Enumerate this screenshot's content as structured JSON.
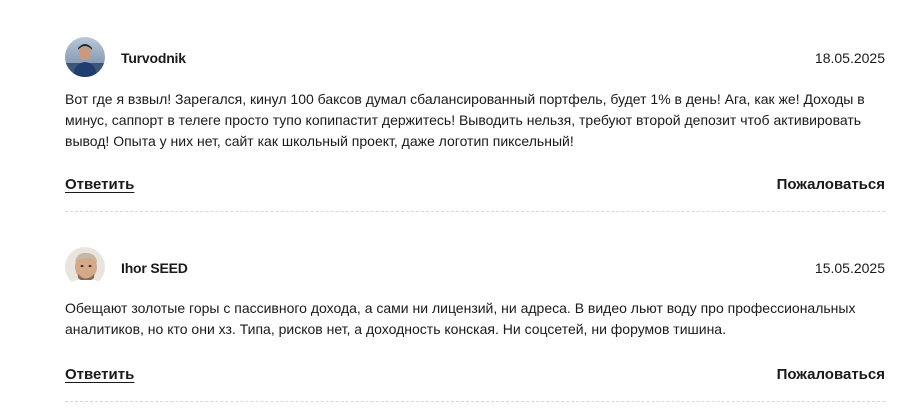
{
  "comments": [
    {
      "author": "Turvodnik",
      "date": "18.05.2025",
      "text": "Вот где я взвыл! Зарегался, кинул 100 баксов думал сбалансированный портфель, будет 1% в день! Ага, как же! Доходы в минус, саппорт в телеге просто тупо копипастит держитесь! Выводить нельзя, требуют второй депозит чтоб активировать вывод! Опыта у них нет, сайт как школьный проект, даже логотип пиксельный!",
      "reply_label": "Ответить",
      "report_label": "Пожаловаться",
      "avatar_icon": "user-avatar-photo"
    },
    {
      "author": "Ihor SEED",
      "date": "15.05.2025",
      "text": "Обещают золотые горы с пассивного дохода, а сами ни лицензий, ни адреса. В видео льют воду про профессиональных аналитиков, но кто они хз. Типа, рисков нет, а доходность конская. Ни соцсетей, ни форумов тишина.",
      "reply_label": "Ответить",
      "report_label": "Пожаловаться",
      "avatar_icon": "user-avatar-photo"
    }
  ]
}
